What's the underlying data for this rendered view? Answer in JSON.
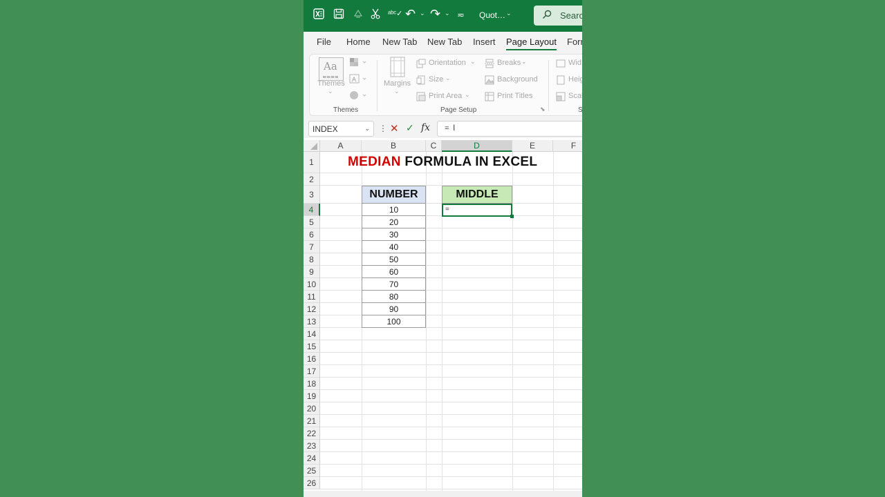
{
  "titlebar": {
    "quick_access_name": "Quot…",
    "search_placeholder": "Search"
  },
  "tabs": [
    "File",
    "Home",
    "New Tab",
    "New Tab",
    "Insert",
    "Page Layout",
    "Form"
  ],
  "ribbon": {
    "themes": {
      "label": "Themes",
      "group": "Themes"
    },
    "page_setup": {
      "margins": "Margins",
      "orientation": "Orientation",
      "size": "Size",
      "print_area": "Print Area",
      "breaks": "Breaks",
      "background": "Background",
      "print_titles": "Print Titles",
      "group": "Page Setup"
    },
    "scale": {
      "width": "Wid",
      "height": "Heig",
      "scale": "Scal",
      "group": "S"
    }
  },
  "formula_bar": {
    "name_box": "INDEX",
    "formula": "=",
    "fx": "fx"
  },
  "columns": [
    "A",
    "B",
    "C",
    "D",
    "E",
    "F"
  ],
  "rows": [
    "1",
    "2",
    "3",
    "4",
    "5",
    "6",
    "7",
    "8",
    "9",
    "10",
    "11",
    "12",
    "13",
    "14",
    "15",
    "16",
    "17",
    "18",
    "19",
    "20",
    "21",
    "22",
    "23",
    "24",
    "25",
    "26"
  ],
  "sheet": {
    "title_red": "MEDIAN",
    "title_rest": " FORMULA IN EXCEL",
    "number_header": "NUMBER",
    "middle_header": "MIDDLE",
    "numbers": [
      "10",
      "20",
      "30",
      "40",
      "50",
      "60",
      "70",
      "80",
      "90",
      "100"
    ],
    "active_cell_value": "="
  },
  "colors": {
    "excel_green": "#117a3c",
    "number_header_bg": "#dae3f3",
    "middle_header_bg": "#c6e9b5",
    "title_red": "#d00000",
    "background": "#418f55"
  }
}
